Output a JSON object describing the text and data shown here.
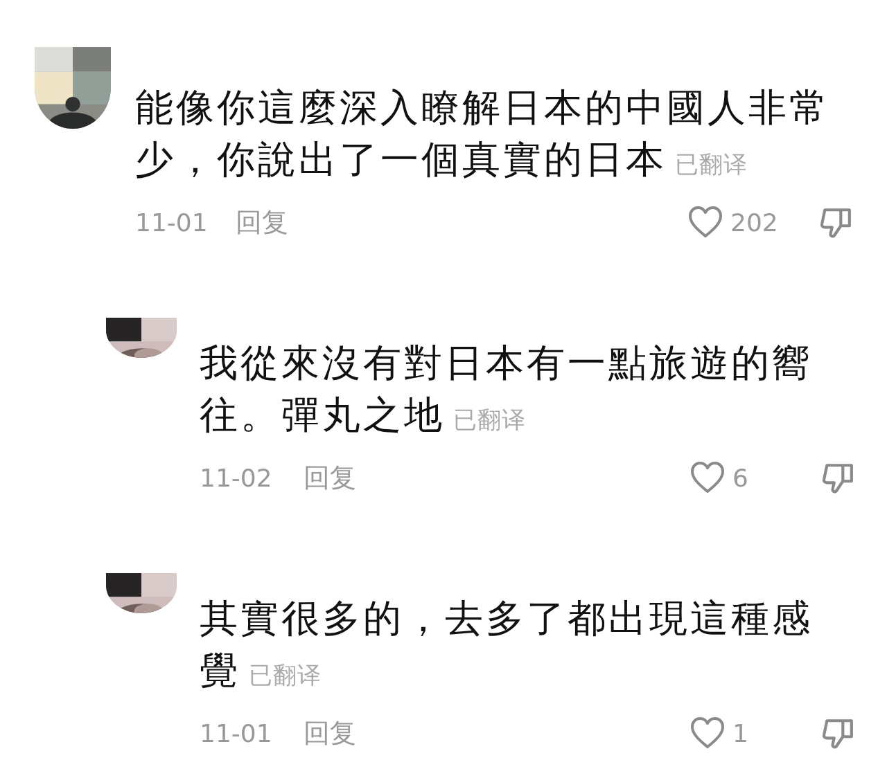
{
  "comments": [
    {
      "kind": "top",
      "lines": [
        "能像你這麼深入瞭解日本的中國人非常",
        "少，你說出了一個真實的日本"
      ],
      "translated": "已翻译",
      "date": "11-01",
      "reply": "回复",
      "likes": "202"
    },
    {
      "kind": "reply",
      "lines": [
        "我從來沒有對日本有一點旅遊的嚮",
        "往。彈丸之地"
      ],
      "translated": "已翻译",
      "date": "11-02",
      "reply": "回复",
      "likes": "6"
    },
    {
      "kind": "reply",
      "lines": [
        "其實很多的，去多了都出現這種感",
        "覺"
      ],
      "translated": "已翻译",
      "date": "11-01",
      "reply": "回复",
      "likes": "1"
    }
  ]
}
